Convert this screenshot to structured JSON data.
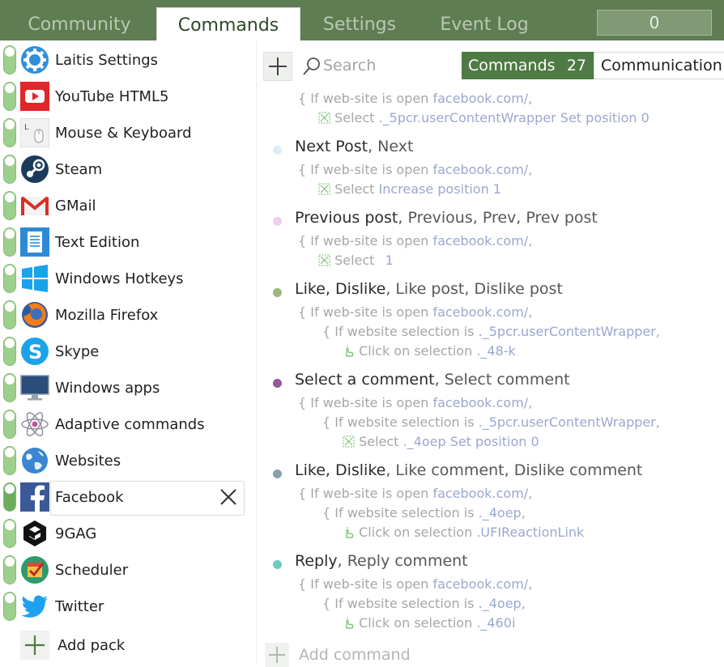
{
  "tabs": [
    {
      "label": "Community"
    },
    {
      "label": "Commands"
    },
    {
      "label": "Settings"
    },
    {
      "label": "Event Log"
    }
  ],
  "counter": {
    "value": "0"
  },
  "packs": [
    {
      "label": "Laitis Settings",
      "icon": "gear-icon"
    },
    {
      "label": "YouTube HTML5",
      "icon": "youtube-icon"
    },
    {
      "label": "Mouse & Keyboard",
      "icon": "mouse-icon"
    },
    {
      "label": "Steam",
      "icon": "steam-icon"
    },
    {
      "label": "GMail",
      "icon": "gmail-icon"
    },
    {
      "label": "Text Edition",
      "icon": "document-icon"
    },
    {
      "label": "Windows Hotkeys",
      "icon": "windows-icon"
    },
    {
      "label": "Mozilla Firefox",
      "icon": "firefox-icon"
    },
    {
      "label": "Skype",
      "icon": "skype-icon"
    },
    {
      "label": "Windows apps",
      "icon": "monitor-icon"
    },
    {
      "label": "Adaptive commands",
      "icon": "atom-icon"
    },
    {
      "label": "Websites",
      "icon": "globe-icon"
    },
    {
      "label": "Facebook",
      "icon": "facebook-icon"
    },
    {
      "label": "9GAG",
      "icon": "9gag-icon"
    },
    {
      "label": "Scheduler",
      "icon": "scheduler-icon"
    },
    {
      "label": "Twitter",
      "icon": "twitter-icon"
    }
  ],
  "add_pack_label": "Add pack",
  "toolbar": {
    "search_placeholder": "Search",
    "commands_label": "Commands",
    "commands_count": "27",
    "communication_label": "Communication"
  },
  "commands": [
    {
      "lines": [
        {
          "k": "{ If web-site is open ",
          "v": "facebook.com/,"
        },
        {
          "k": "Select ",
          "v": "._5pcr.userContentWrapper Set position 0"
        }
      ]
    },
    {
      "title": "Next Post",
      "alts": ", Next",
      "dot": "#dbeef5",
      "lines": [
        {
          "k": "{ If web-site is open ",
          "v": "facebook.com/,"
        },
        {
          "k": "Select ",
          "v": "Increase position 1"
        }
      ]
    },
    {
      "title": "Previous post",
      "alts": ", Previous, Prev, Prev post",
      "dot": "#f0cdf3",
      "lines": [
        {
          "k": "{ If web-site is open ",
          "v": "facebook.com/,"
        },
        {
          "k": "Select ",
          "v": "1"
        }
      ]
    },
    {
      "title": "Like, Dislike",
      "alts": ", Like post, Dislike post",
      "dot": "#9bb97a",
      "lines": [
        {
          "k": "{ If web-site is open ",
          "v": "facebook.com/,"
        },
        {
          "k": "{ If website selection is ",
          "v": "._5pcr.userContentWrapper,"
        },
        {
          "k": "Click on selection ",
          "v": "._48-k"
        }
      ]
    },
    {
      "title": "Select a comment",
      "alts": ", Select comment",
      "dot": "#94599b",
      "lines": [
        {
          "k": "{ If web-site is open ",
          "v": "facebook.com/,"
        },
        {
          "k": "{ If website selection is ",
          "v": "._5pcr.userContentWrapper,"
        },
        {
          "k": "Select ",
          "v": "._4oep Set position 0"
        }
      ]
    },
    {
      "title": "Like, Dislike",
      "alts": ", Like comment, Dislike comment",
      "dot": "#88a2ac",
      "lines": [
        {
          "k": "{ If web-site is open ",
          "v": "facebook.com/,"
        },
        {
          "k": "{ If website selection is ",
          "v": "._4oep,"
        },
        {
          "k": "Click on selection ",
          "v": ".UFIReactionLink"
        }
      ]
    },
    {
      "title": "Reply",
      "alts": ", Reply comment",
      "dot": "#6dcbbb",
      "lines": [
        {
          "k": "{ If web-site is open ",
          "v": "facebook.com/,"
        },
        {
          "k": "{ If website selection is ",
          "v": "._4oep,"
        },
        {
          "k": "Click on selection ",
          "v": "._460i"
        }
      ]
    }
  ],
  "add_command_label": "Add command"
}
